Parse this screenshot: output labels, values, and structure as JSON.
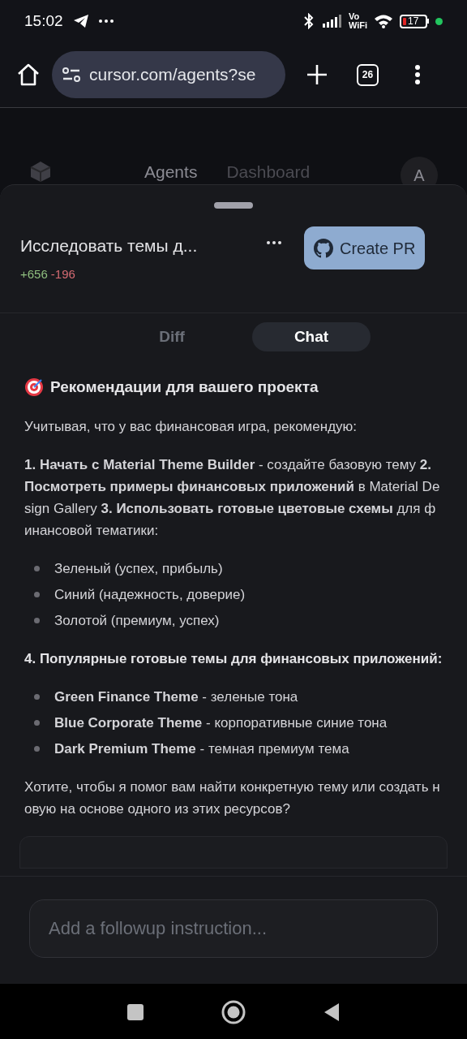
{
  "status_bar": {
    "time": "15:02",
    "network_label": [
      "Vo",
      "WiFi"
    ],
    "battery": "17"
  },
  "browser": {
    "url": "cursor.com/agents?se",
    "tab_count": "26"
  },
  "site_nav": {
    "items": [
      {
        "label": "Agents",
        "selected": true
      },
      {
        "label": "Dashboard",
        "selected": false
      }
    ],
    "avatar": "A"
  },
  "sheet": {
    "title": "Исследовать темы д...",
    "additions": "+656",
    "deletions": "-196",
    "create_pr": "Create PR",
    "tabs": [
      {
        "label": "Diff",
        "selected": false
      },
      {
        "label": "Chat",
        "selected": true
      }
    ],
    "message": [
      {
        "kind": "heading",
        "text": "Рекомендации для вашего проекта"
      },
      {
        "kind": "paragraph",
        "text": "Учитывая, что у вас финансовая игра, рекомендую:"
      },
      {
        "kind": "paragraph",
        "text": "**1. Начать с Material Theme Builder** - создайте базовую тему **2. Посмотреть примеры финансовых приложений** в Material Design Gallery **3. Использовать готовые цветовые схемы** для финансовой тематики:"
      },
      {
        "kind": "bullets",
        "items": [
          "Зеленый (успех, прибыль)",
          "Синий (надежность, доверие)",
          "Золотой (премиум, успех)"
        ]
      },
      {
        "kind": "subheading",
        "text": "4. Популярные готовые темы для финансовых приложений:"
      },
      {
        "kind": "bullets",
        "items": [
          "**Green Finance Theme** - зеленые тона",
          "**Blue Corporate Theme** - корпоративные синие тона",
          "**Dark Premium Theme** - темная премиум тема"
        ]
      },
      {
        "kind": "paragraph",
        "text": "Хотите, чтобы я помог вам найти конкретную тему или создать новую на основе одного из этих ресурсов?"
      }
    ],
    "input": {
      "placeholder": "Add a followup instruction..."
    }
  }
}
